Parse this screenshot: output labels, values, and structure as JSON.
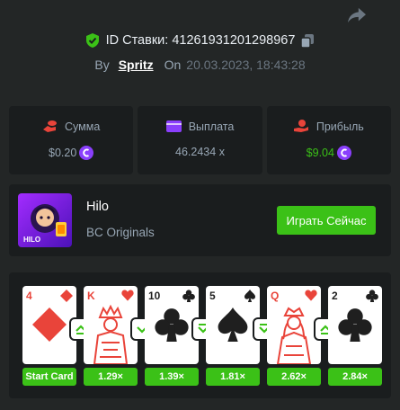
{
  "bet": {
    "id_label": "ID Ставки: 41261931201298967",
    "by_label": "By",
    "user": "Spritz",
    "on_label": "On",
    "date": "20.03.2023, 18:43:28"
  },
  "stats": [
    {
      "icon": "coin-stack-icon",
      "label": "Сумма",
      "value": "$0.20",
      "coin": true
    },
    {
      "icon": "wallet-icon",
      "label": "Выплата",
      "value": "46.2434 x",
      "coin": false
    },
    {
      "icon": "hand-coin-icon",
      "label": "Прибыль",
      "value": "$9.04",
      "coin": true
    }
  ],
  "game": {
    "title": "Hilo",
    "subtitle": "BC Originals",
    "thumb_label": "HILO",
    "play_label": "Играть Сейчас"
  },
  "cards": [
    {
      "rank": "4",
      "suit": "diamond",
      "color": "red",
      "badge": "Start Card"
    },
    {
      "rank": "K",
      "suit": "heart",
      "color": "red",
      "badge": "1.29×",
      "arrow": "up"
    },
    {
      "rank": "10",
      "suit": "club",
      "color": "black",
      "badge": "1.39×",
      "arrow": "down"
    },
    {
      "rank": "5",
      "suit": "spade",
      "color": "black",
      "badge": "1.81×",
      "arrow": "down"
    },
    {
      "rank": "Q",
      "suit": "heart",
      "color": "red",
      "badge": "2.62×",
      "arrow": "down"
    },
    {
      "rank": "2",
      "suit": "club",
      "color": "black",
      "badge": "2.84×",
      "arrow": "up"
    }
  ],
  "colors": {
    "accent_green": "#3bc117",
    "card_red": "#e9443a",
    "panel": "#1a1d1e",
    "background": "#232626",
    "coin_purple": "#8a3ffc"
  }
}
